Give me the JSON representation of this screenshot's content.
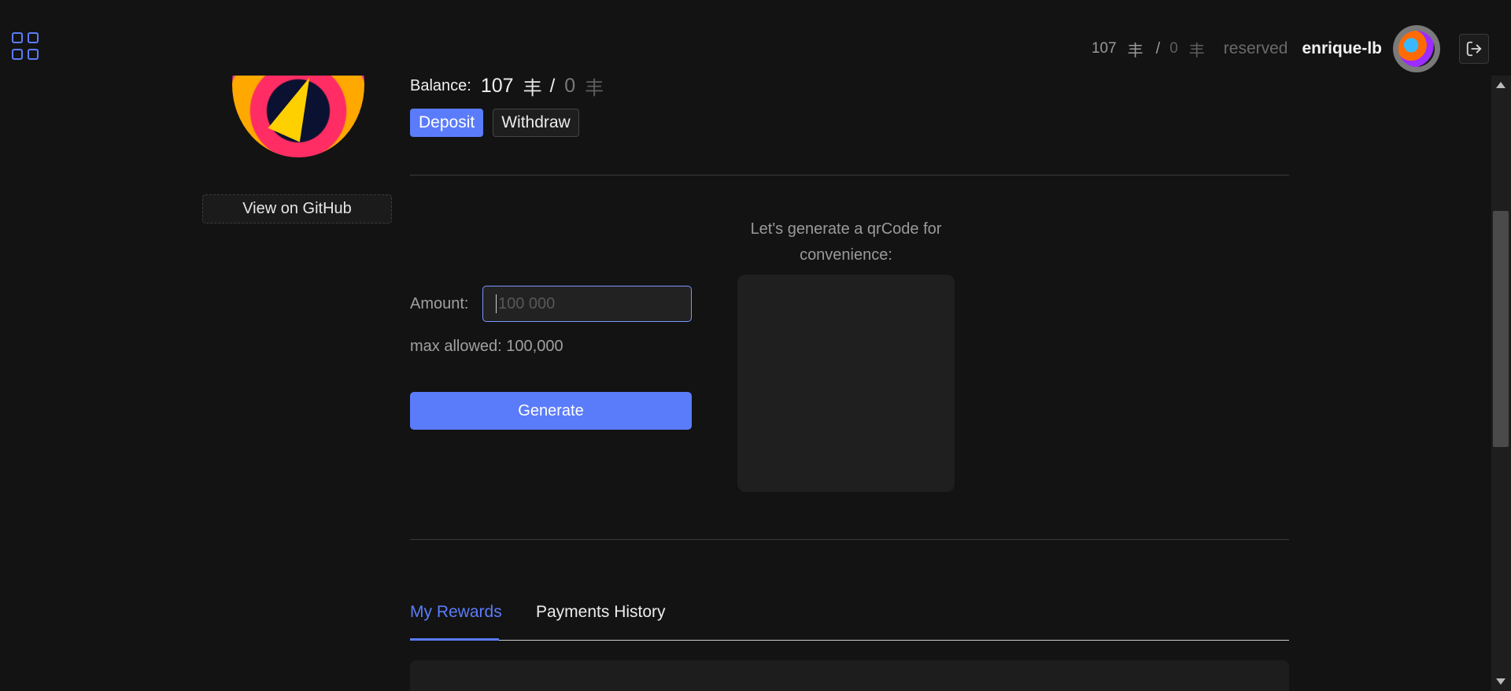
{
  "header": {
    "balance": "107",
    "slash": "/",
    "reserved_amount": "0",
    "reserved_label": "reserved",
    "username": "enrique-lb",
    "sats_symbol": "丰",
    "apps_icon": "apps-grid-icon",
    "logout_icon": "logout-icon"
  },
  "project": {
    "github_button": "View on GitHub"
  },
  "balance": {
    "label": "Balance:",
    "value": "107",
    "slash": "/",
    "reserved": "0",
    "sats_symbol": "丰"
  },
  "actions": {
    "deposit": "Deposit",
    "withdraw": "Withdraw"
  },
  "deposit_form": {
    "amount_label": "Amount:",
    "amount_placeholder": "100 000",
    "max_allowed": "max allowed: 100,000",
    "generate_button": "Generate"
  },
  "qr": {
    "caption": "Let's generate a qrCode for convenience:"
  },
  "tabs": {
    "my_rewards": "My Rewards",
    "payments_history": "Payments History"
  },
  "colors": {
    "accent": "#5b7cfa",
    "background": "#131313",
    "panel": "#1f1f1f"
  }
}
